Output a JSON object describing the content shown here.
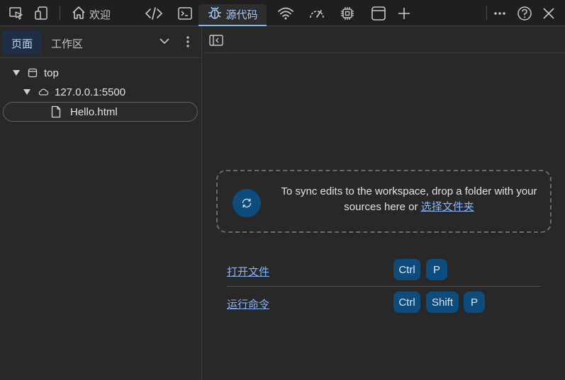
{
  "toolbar": {
    "tabs": [
      {
        "label": "欢迎",
        "icon": "home-icon"
      },
      {
        "label": "",
        "icon": "code-icon"
      },
      {
        "label": "",
        "icon": "console-icon"
      },
      {
        "label": "源代码",
        "icon": "bug-icon",
        "active": true
      },
      {
        "label": "",
        "icon": "wifi-icon"
      },
      {
        "label": "",
        "icon": "performance-icon"
      },
      {
        "label": "",
        "icon": "cpu-icon"
      },
      {
        "label": "",
        "icon": "application-icon"
      }
    ],
    "add_tab": "+"
  },
  "left_panel": {
    "tabs": [
      {
        "label": "页面",
        "active": true
      },
      {
        "label": "工作区",
        "active": false
      }
    ],
    "tree": [
      {
        "label": "top",
        "level": 0,
        "icon": "frame-icon",
        "expanded": true
      },
      {
        "label": "127.0.0.1:5500",
        "level": 1,
        "icon": "cloud-icon",
        "expanded": true
      },
      {
        "label": "Hello.html",
        "level": 2,
        "icon": "file-icon",
        "selected": true
      }
    ]
  },
  "right_panel": {
    "dropzone": {
      "text": "To sync edits to the workspace, drop a folder with your sources here or",
      "link": "选择文件夹"
    },
    "shortcuts": [
      {
        "action": "打开文件",
        "keys": [
          "Ctrl",
          "P"
        ]
      },
      {
        "action": "运行命令",
        "keys": [
          "Ctrl",
          "Shift",
          "P"
        ]
      }
    ]
  },
  "colors": {
    "accent": "#8ab4f8",
    "key_bg": "#0e4c7e",
    "panel_bg": "#282828",
    "toolbar_bg": "#1f1f1f"
  }
}
